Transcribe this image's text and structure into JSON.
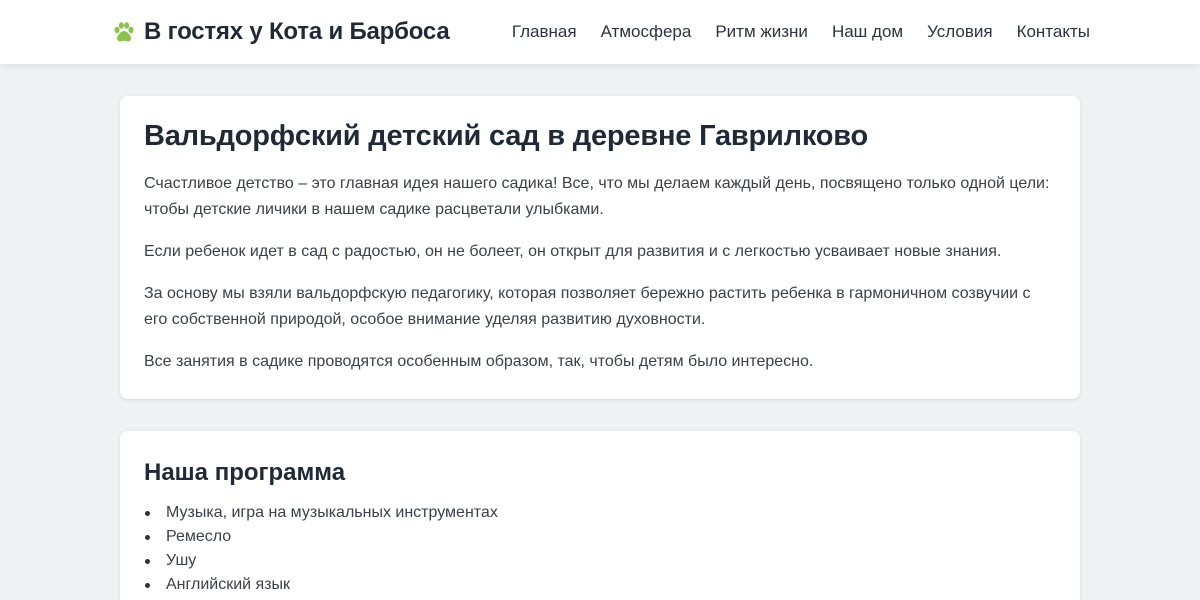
{
  "header": {
    "logo_icon": "paw-icon",
    "logo_color": "#8bc34a",
    "title": "В гостях у Кота и Барбоса",
    "nav": [
      {
        "label": "Главная"
      },
      {
        "label": "Атмосфера"
      },
      {
        "label": "Ритм жизни"
      },
      {
        "label": "Наш дом"
      },
      {
        "label": "Условия"
      },
      {
        "label": "Контакты"
      }
    ]
  },
  "intro": {
    "title": "Вальдорфский детский сад в деревне Гаврилково",
    "paragraphs": [
      "Счастливое детство – это главная идея нашего садика! Все, что мы делаем каждый день, посвящено только одной цели: чтобы детские личики в нашем садике расцветали улыбками.",
      "Если ребенок идет в сад с радостью, он не болеет, он открыт для развития и с легкостью усваивает новые знания.",
      "За основу мы взяли вальдорфскую педагогику, которая позволяет бережно растить ребенка в гармоничном созвучии с его собственной природой, особое внимание уделяя развитию духовности.",
      "Все занятия в садике проводятся особенным образом, так, чтобы детям было интересно."
    ]
  },
  "program": {
    "title": "Наша программа",
    "items": [
      "Музыка, игра на музыкальных инструментах",
      "Ремесло",
      "Ушу",
      "Английский язык"
    ]
  }
}
